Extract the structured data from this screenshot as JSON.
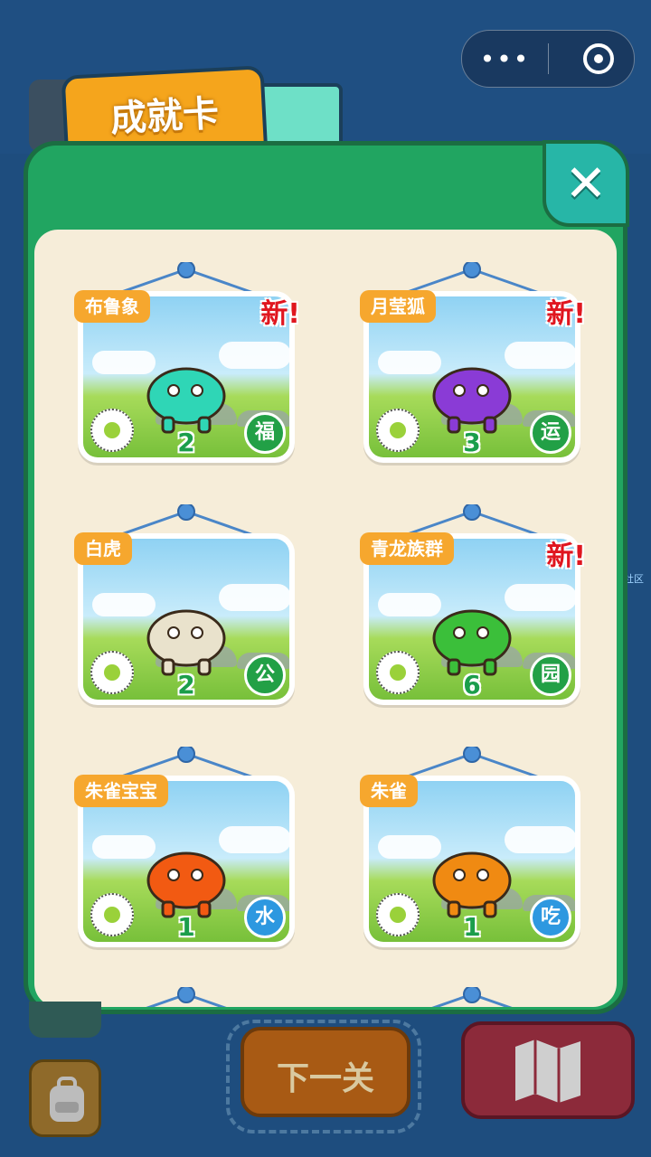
{
  "tabs": {
    "achievement_label": "成就卡"
  },
  "watermark": "流星社区",
  "cards": [
    {
      "name": "布鲁象",
      "new_label": "新!",
      "count": "2",
      "char": "福",
      "badge_color": "#22a046",
      "creature": "elephant-creature",
      "creature_color": "#2fd6b6"
    },
    {
      "name": "月莹狐",
      "new_label": "新!",
      "count": "3",
      "char": "运",
      "badge_color": "#22a046",
      "creature": "moon-fox-creature",
      "creature_color": "#8a3bd6"
    },
    {
      "name": "白虎",
      "new_label": "",
      "count": "2",
      "char": "公",
      "badge_color": "#22a046",
      "creature": "white-tiger-creature",
      "creature_color": "#e9e2cc"
    },
    {
      "name": "青龙族群",
      "new_label": "新!",
      "count": "6",
      "char": "园",
      "badge_color": "#22a046",
      "creature": "green-dragon-creature",
      "creature_color": "#3bbf3a"
    },
    {
      "name": "朱雀宝宝",
      "new_label": "",
      "count": "1",
      "char": "水",
      "badge_color": "#2d98e0",
      "creature": "baby-phoenix-creature",
      "creature_color": "#f25a12"
    },
    {
      "name": "朱雀",
      "new_label": "",
      "count": "1",
      "char": "吃",
      "badge_color": "#2d98e0",
      "creature": "phoenix-creature",
      "creature_color": "#f08a12"
    }
  ],
  "bottom": {
    "next_label": "下一关"
  },
  "icons": {
    "close": "close-icon",
    "map": "map-icon",
    "bag": "backpack-icon",
    "menu": "more-dots-icon",
    "capsule_close": "target-icon"
  }
}
